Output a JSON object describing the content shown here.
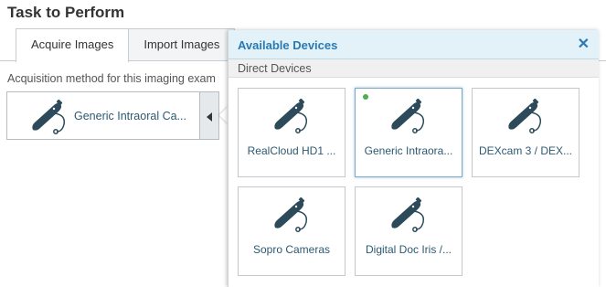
{
  "page_title": "Task to Perform",
  "tabs": [
    {
      "label": "Acquire Images",
      "active": true
    },
    {
      "label": "Import Images",
      "active": false
    }
  ],
  "acquisition": {
    "label": "Acquisition method for this imaging exam",
    "selected_device": "Generic Intraoral Ca...",
    "icon": "intraoral-camera-icon"
  },
  "popup": {
    "title": "Available Devices",
    "close_glyph": "✕",
    "section_label": "Direct Devices",
    "devices": [
      {
        "label": "RealCloud HD1 ...",
        "icon": "intraoral-camera-icon",
        "selected": false,
        "status": ""
      },
      {
        "label": "Generic Intraora...",
        "icon": "intraoral-camera-icon",
        "selected": true,
        "status": "connected"
      },
      {
        "label": "DEXcam 3 / DEX...",
        "icon": "intraoral-camera-icon",
        "selected": false,
        "status": ""
      },
      {
        "label": "Sopro Cameras",
        "icon": "intraoral-camera-icon",
        "selected": false,
        "status": ""
      },
      {
        "label": "Digital Doc Iris /...",
        "icon": "intraoral-camera-icon",
        "selected": false,
        "status": ""
      }
    ]
  },
  "colors": {
    "accent": "#2a7ab3",
    "header_bg": "#e3f1f9",
    "device_text": "#2c5a73",
    "status_green": "#4caf50",
    "icon_dark": "#2c4a5a"
  }
}
